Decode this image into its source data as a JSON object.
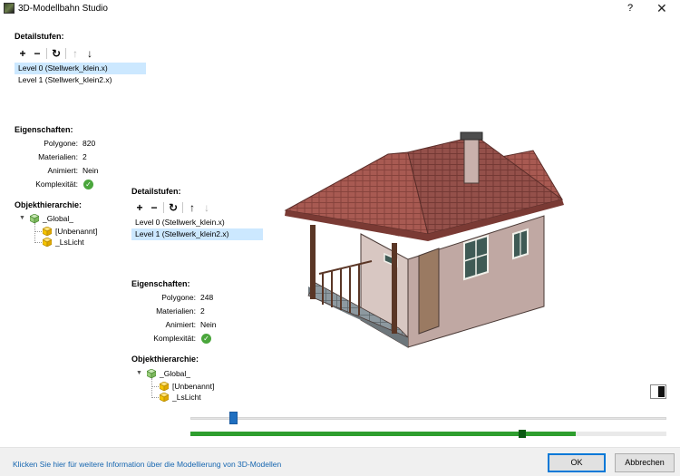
{
  "window": {
    "title": "3D-Modellbahn Studio",
    "help": "?",
    "close": "✕"
  },
  "left_panel": {
    "detail_title": "Detailstufen:",
    "levels": [
      {
        "label": "Level 0 (Stellwerk_klein.x)",
        "selected": true
      },
      {
        "label": "Level 1 (Stellwerk_klein2.x)",
        "selected": false
      }
    ],
    "props_title": "Eigenschaften:",
    "props": [
      {
        "key": "Polygone:",
        "value": "820"
      },
      {
        "key": "Materialien:",
        "value": "2"
      },
      {
        "key": "Animiert:",
        "value": "Nein"
      },
      {
        "key": "Komplexität:",
        "value": ""
      }
    ],
    "hierarchy_title": "Objekthierarchie:",
    "tree": {
      "root": "_Global_",
      "children": [
        "[Unbenannt]",
        "_LsLicht"
      ]
    }
  },
  "middle_panel": {
    "detail_title": "Detailstufen:",
    "levels": [
      {
        "label": "Level 0 (Stellwerk_klein.x)",
        "selected": false
      },
      {
        "label": "Level 1 (Stellwerk_klein2.x)",
        "selected": true
      }
    ],
    "props_title": "Eigenschaften:",
    "props": [
      {
        "key": "Polygone:",
        "value": "248"
      },
      {
        "key": "Materialien:",
        "value": "2"
      },
      {
        "key": "Animiert:",
        "value": "Nein"
      },
      {
        "key": "Komplexität:",
        "value": ""
      }
    ],
    "hierarchy_title": "Objekthierarchie:",
    "tree": {
      "root": "_Global_",
      "children": [
        "[Unbenannt]",
        "_LsLicht"
      ]
    }
  },
  "toolbar_icons": {
    "add": "+",
    "remove": "−",
    "refresh": "↻",
    "up": "↑",
    "down": "↓"
  },
  "sliders": {
    "compare_position": 0.09,
    "lod_progress": 0.81
  },
  "colors": {
    "accent": "#0078d7",
    "progress": "#2e9e2e",
    "slider": "#1f6fc0",
    "ok": "#4aa63c",
    "selection": "#cce8ff",
    "link": "#1666b0"
  },
  "footer": {
    "info_link": "Klicken Sie hier für weitere Information über die Modellierung von 3D-Modellen",
    "ok_label": "OK",
    "cancel_label": "Abbrechen"
  }
}
